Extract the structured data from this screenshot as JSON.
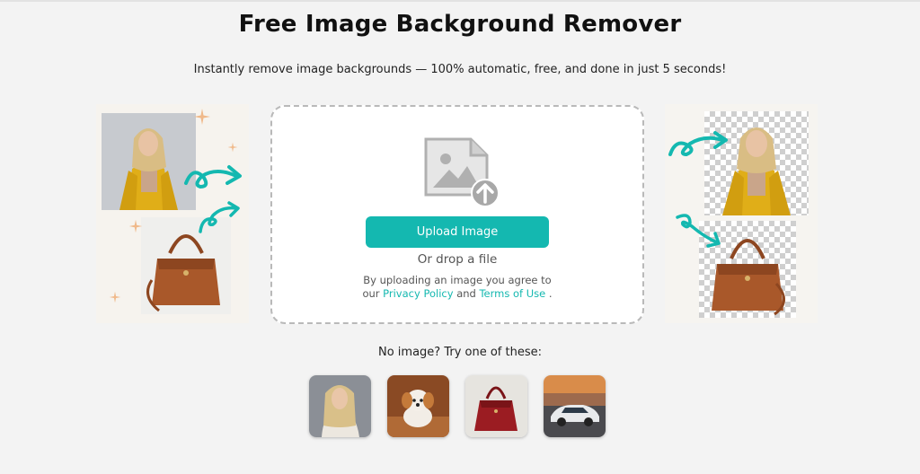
{
  "header": {
    "title": "Free Image Background Remover",
    "subtitle": "Instantly remove image backgrounds — 100% automatic, free, and done in just 5 seconds!"
  },
  "upload": {
    "button_label": "Upload Image",
    "drop_text": "Or drop a file",
    "agree_prefix": "By uploading an image you agree to",
    "agree_our": "our",
    "privacy_link": "Privacy Policy",
    "agree_and": "and",
    "terms_link": "Terms of Use",
    "agree_end": "."
  },
  "samples": {
    "label": "No image? Try one of these:",
    "items": [
      "woman-portrait",
      "puppy",
      "red-handbag",
      "sports-car"
    ]
  },
  "colors": {
    "accent": "#14b8b0",
    "background": "#f3f3f3",
    "jacket": "#e2b21c",
    "bag": "#a9582a"
  },
  "icons": [
    "image-upload-icon",
    "arrow-curl-icon",
    "sparkle-icon"
  ]
}
